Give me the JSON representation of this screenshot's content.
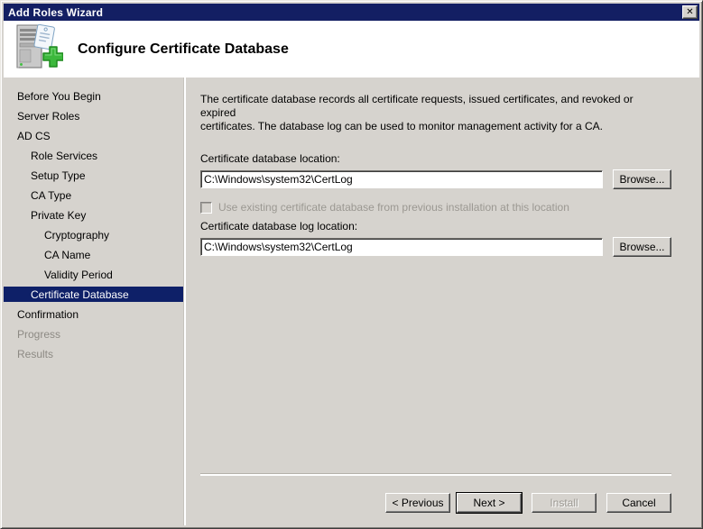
{
  "window": {
    "title": "Add Roles Wizard",
    "close_icon": "✕"
  },
  "header": {
    "title": "Configure Certificate Database"
  },
  "sidebar": {
    "items": [
      {
        "label": "Before You Begin",
        "level": 0,
        "state": "normal"
      },
      {
        "label": "Server Roles",
        "level": 0,
        "state": "normal"
      },
      {
        "label": "AD CS",
        "level": 0,
        "state": "normal"
      },
      {
        "label": "Role Services",
        "level": 1,
        "state": "normal"
      },
      {
        "label": "Setup Type",
        "level": 1,
        "state": "normal"
      },
      {
        "label": "CA Type",
        "level": 1,
        "state": "normal"
      },
      {
        "label": "Private Key",
        "level": 1,
        "state": "normal"
      },
      {
        "label": "Cryptography",
        "level": 2,
        "state": "normal"
      },
      {
        "label": "CA Name",
        "level": 2,
        "state": "normal"
      },
      {
        "label": "Validity Period",
        "level": 2,
        "state": "normal"
      },
      {
        "label": "Certificate Database",
        "level": 1,
        "state": "selected"
      },
      {
        "label": "Confirmation",
        "level": 0,
        "state": "normal"
      },
      {
        "label": "Progress",
        "level": 0,
        "state": "pending"
      },
      {
        "label": "Results",
        "level": 0,
        "state": "pending"
      }
    ]
  },
  "main": {
    "description": "The certificate database records all certificate requests, issued certificates, and revoked or expired\ncertificates. The database log can be used to monitor management activity for a CA.",
    "db_location": {
      "label": "Certificate database location:",
      "value": "C:\\Windows\\system32\\CertLog",
      "browse_label": "Browse..."
    },
    "use_existing_checkbox": {
      "label": "Use existing certificate database from previous installation at this location",
      "checked": false,
      "enabled": false
    },
    "log_location": {
      "label": "Certificate database log location:",
      "value": "C:\\Windows\\system32\\CertLog",
      "browse_label": "Browse..."
    }
  },
  "footer": {
    "buttons": [
      {
        "label": "< Previous",
        "enabled": true,
        "default": false
      },
      {
        "label": "Next >",
        "enabled": true,
        "default": true
      },
      {
        "label": "Install",
        "enabled": false,
        "default": false
      },
      {
        "label": "Cancel",
        "enabled": true,
        "default": false
      }
    ]
  },
  "colors": {
    "titlebar": "#131F63",
    "selection": "#0E2068",
    "body": "#D6D3CE",
    "header_bg": "#FFFFFF",
    "disabled_text": "#9B9892",
    "accent_green": "#3CB83C"
  }
}
